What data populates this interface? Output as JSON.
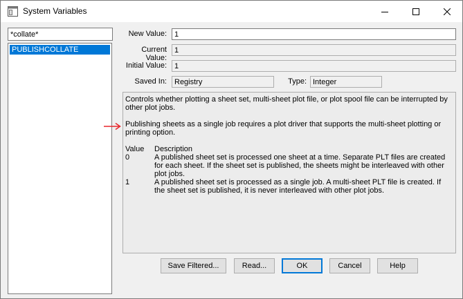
{
  "window": {
    "title": "System Variables",
    "icons": {
      "app": "window-icon",
      "minimize": "minimize-icon",
      "maximize": "maximize-icon",
      "close": "close-icon"
    }
  },
  "filter": {
    "value": "*collate*"
  },
  "variables": [
    "PUBLISHCOLLATE"
  ],
  "fields": {
    "new_value_label": "New Value:",
    "new_value": "1",
    "current_value_label": "Current Value:",
    "current_value": "1",
    "initial_value_label": "Initial Value:",
    "initial_value": "1",
    "saved_in_label": "Saved In:",
    "saved_in": "Registry",
    "type_label": "Type:",
    "type": "Integer"
  },
  "description": {
    "intro": "Controls whether plotting a sheet set, multi-sheet plot file, or plot spool file can be interrupted by other plot jobs.",
    "note": "Publishing sheets as a single job requires a plot driver that supports the multi-sheet plotting or printing option.",
    "header_value": "Value",
    "header_description": "Description",
    "rows": [
      {
        "value": "0",
        "text": "A published sheet set is processed one sheet at a time. Separate PLT files are created for each sheet. If the sheet set is published, the sheets might be interleaved with other plot jobs."
      },
      {
        "value": "1",
        "text": "A published sheet set is processed as a single job. A multi-sheet PLT file is created. If the sheet set is published, it is never interleaved with other plot jobs."
      }
    ]
  },
  "annotation": {
    "color": "#e8262b",
    "icon": "arrow-icon"
  },
  "buttons": {
    "save_filtered": "Save Filtered...",
    "read": "Read...",
    "ok": "OK",
    "cancel": "Cancel",
    "help": "Help"
  },
  "colors": {
    "selection": "#0078d7",
    "background": "#f0f0f0"
  }
}
